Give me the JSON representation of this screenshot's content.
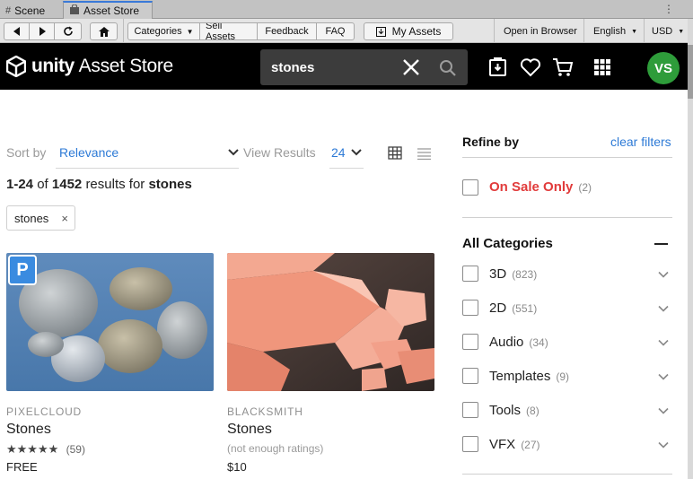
{
  "editor_tabs": [
    {
      "label": "Scene",
      "icon": "grid-icon"
    },
    {
      "label": "Asset Store",
      "icon": "bag-icon",
      "active": true
    }
  ],
  "toolbar": {
    "categories": "Categories",
    "sell_assets": "Sell Assets",
    "feedback": "Feedback",
    "faq": "FAQ",
    "my_assets": "My Assets",
    "open_in_browser": "Open in Browser",
    "language": "English",
    "currency": "USD"
  },
  "header": {
    "brand_bold": "unity",
    "brand_rest": "Asset Store",
    "search_value": "stones",
    "avatar_initials": "VS",
    "avatar_color": "#2e9c3a"
  },
  "sort": {
    "sort_by_label": "Sort by",
    "sort_value": "Relevance",
    "view_results_label": "View Results",
    "view_value": "24"
  },
  "results": {
    "range": "1-24",
    "of": "of",
    "total": "1452",
    "results_for": "results for",
    "query": "stones"
  },
  "filter_chip": {
    "label": "stones",
    "remove": "×"
  },
  "cards": [
    {
      "publisher": "PIXELCLOUD",
      "name": "Stones",
      "stars": "★★★★★",
      "rating_count": "(59)",
      "price": "FREE",
      "badge": "P"
    },
    {
      "publisher": "BLACKSMITH",
      "name": "Stones",
      "rating_note": "(not enough ratings)",
      "price": "$10"
    }
  ],
  "sidebar": {
    "refine_by": "Refine by",
    "clear_filters": "clear filters",
    "on_sale": {
      "label": "On Sale Only",
      "count": "(2)"
    },
    "all_categories": "All Categories",
    "categories": [
      {
        "label": "3D",
        "count": "(823)"
      },
      {
        "label": "2D",
        "count": "(551)"
      },
      {
        "label": "Audio",
        "count": "(34)"
      },
      {
        "label": "Templates",
        "count": "(9)"
      },
      {
        "label": "Tools",
        "count": "(8)"
      },
      {
        "label": "VFX",
        "count": "(27)"
      }
    ]
  },
  "colors": {
    "link": "#2d7ad6",
    "sale": "#e13b3b",
    "accent_tab": "#3a79d8"
  }
}
